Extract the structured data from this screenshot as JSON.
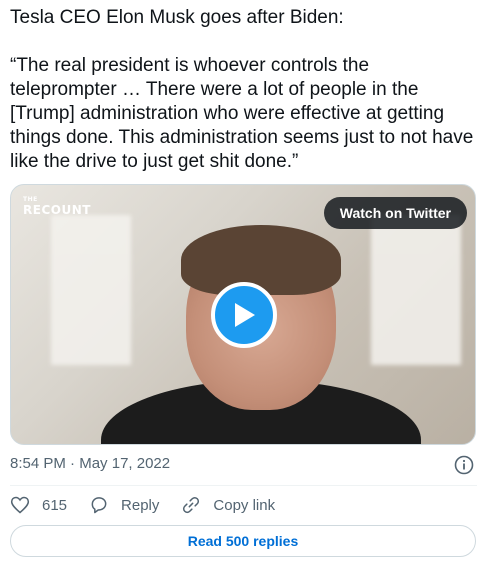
{
  "tweet": {
    "headline": "Tesla CEO Elon Musk goes after Biden:",
    "quote": "“The real president is whoever controls the teleprompter … There were a lot of people in the [Trump] administration who were effective at getting things done. This administration seems just to not have like the drive to just get shit done.”"
  },
  "video": {
    "logo_small": "THE",
    "logo_main": "RECOUNT",
    "watch_label": "Watch on Twitter"
  },
  "meta": {
    "time": "8:54 PM",
    "separator": "·",
    "date": "May 17, 2022"
  },
  "actions": {
    "like_count": "615",
    "reply_label": "Reply",
    "copy_label": "Copy link"
  },
  "read_replies_label": "Read 500 replies",
  "colors": {
    "accent": "#1d9bf0",
    "link": "#006fd6",
    "muted": "#536471"
  }
}
